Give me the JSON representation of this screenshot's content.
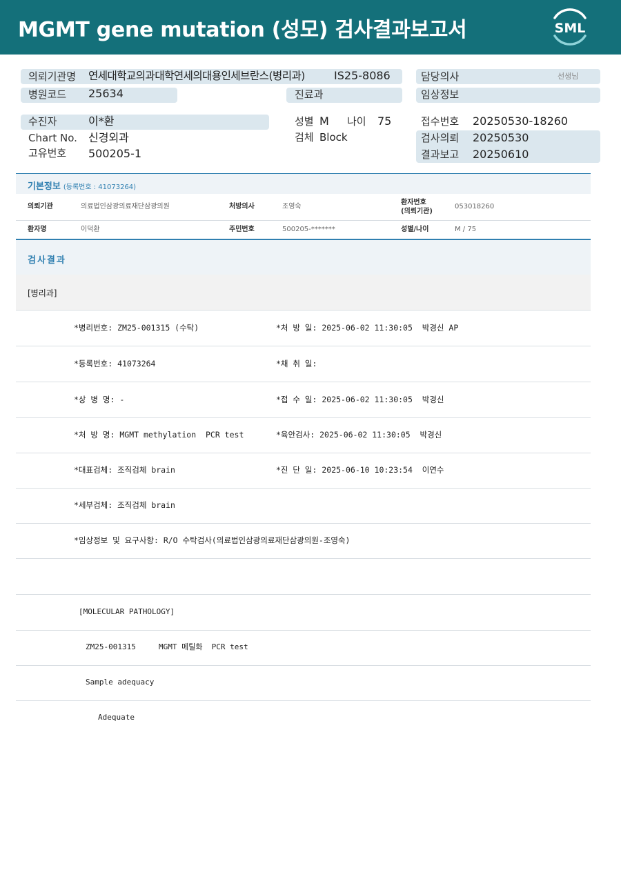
{
  "header": {
    "title": "MGMT gene mutation (성모) 검사결과보고서",
    "logo_text": "SML",
    "brand_color": "#14707a"
  },
  "top_info": {
    "requesting_institution": {
      "label": "의뢰기관명",
      "value": "연세대학교의과대학연세의대용인세브란스(병리과)"
    },
    "sample_id": "IS25-8086",
    "attending_doctor": {
      "label": "담당의사",
      "suffix": "선생님"
    },
    "hospital_code": {
      "label": "병원코드",
      "value": "25634"
    },
    "department": {
      "label": "진료과"
    },
    "clinical_info": {
      "label": "임상정보"
    },
    "patient": {
      "label": "수진자",
      "value": "이*환"
    },
    "sex": {
      "label": "성별",
      "value": "M"
    },
    "age": {
      "label": "나이",
      "value": "75"
    },
    "receipt_no": {
      "label": "접수번호",
      "value": "20250530-18260"
    },
    "chart_no": {
      "label": "Chart No.",
      "value": "신경외과"
    },
    "specimen": {
      "label": "검체",
      "value": "Block"
    },
    "test_request": {
      "label": "검사의뢰",
      "value": "20250530"
    },
    "unique_no": {
      "label": "고유번호",
      "value": "500205-1"
    },
    "result_report": {
      "label": "결과보고",
      "value": "20250610"
    }
  },
  "basic_info": {
    "title": "기본정보",
    "reg_note": "(등록번호 : 41073264)",
    "row1": {
      "inst_label": "의뢰기관",
      "inst_value": "의료법인삼광의료재단삼광의원",
      "doctor_label": "처방의사",
      "doctor_value": "조영숙",
      "pno_label_1": "환자번호",
      "pno_label_2": "(의뢰기관)",
      "pno_value": "053018260"
    },
    "row2": {
      "name_label": "환자명",
      "name_value": "이덕환",
      "rrn_label": "주민번호",
      "rrn_value": "500205-*******",
      "sexage_label": "성별/나이",
      "sexage_value": "M / 75"
    }
  },
  "results": {
    "title": "검사결과",
    "section": "[병리과]",
    "rows": [
      {
        "left": "*병리번호: ZM25-001315 (수탁)",
        "right": "*처 방 일: 2025-06-02 11:30:05  박경신 AP"
      },
      {
        "left": "*등록번호: 41073264",
        "right": "*채 취 일:"
      },
      {
        "left": "*상 병 명: -",
        "right": "*접 수 일: 2025-06-02 11:30:05  박경신"
      },
      {
        "left": "*처 방 명: MGMT methylation  PCR test",
        "right": "*육안검사: 2025-06-02 11:30:05  박경신"
      },
      {
        "left": "*대표검체: 조직검체 brain",
        "right": "*진 단 일: 2025-06-10 10:23:54  이연수"
      },
      {
        "left": "*세부검체: 조직검체 brain",
        "right": ""
      },
      {
        "left": "*임상정보 및 요구사항: R/O 수탁검사(의료법인삼광의료재단삼광의원-조영숙)",
        "right": ""
      },
      {
        "left": "",
        "right": ""
      }
    ],
    "molecular": [
      "[MOLECULAR PATHOLOGY]",
      "ZM25-001315     MGMT 메틸화  PCR test",
      "Sample adequacy",
      "Adequate"
    ]
  }
}
